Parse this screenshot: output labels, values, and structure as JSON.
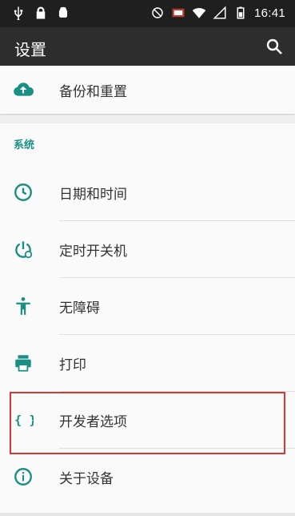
{
  "status_bar": {
    "time": "16:41",
    "icons": [
      "usb-icon",
      "lock-icon",
      "android-icon",
      "do-not-disturb-icon",
      "cast-icon",
      "wifi-icon",
      "signal-icon",
      "battery-icon"
    ]
  },
  "app_bar": {
    "title": "设置",
    "search_icon": "search-icon"
  },
  "top_card": {
    "items": [
      {
        "label": "备份和重置",
        "icon": "cloud-upload-icon"
      }
    ]
  },
  "system_section": {
    "title": "系统",
    "items": [
      {
        "label": "日期和时间",
        "icon": "clock-icon"
      },
      {
        "label": "定时开关机",
        "icon": "power-schedule-icon"
      },
      {
        "label": "无障碍",
        "icon": "accessibility-icon"
      },
      {
        "label": "打印",
        "icon": "printer-icon"
      },
      {
        "label": "开发者选项",
        "icon": "developer-braces-icon"
      },
      {
        "label": "关于设备",
        "icon": "info-icon"
      }
    ]
  },
  "colors": {
    "accent": "#1a8f84",
    "highlight_border": "#d9382f",
    "app_bar": "#2d2d2d",
    "status_bar": "#1f1f1f"
  }
}
